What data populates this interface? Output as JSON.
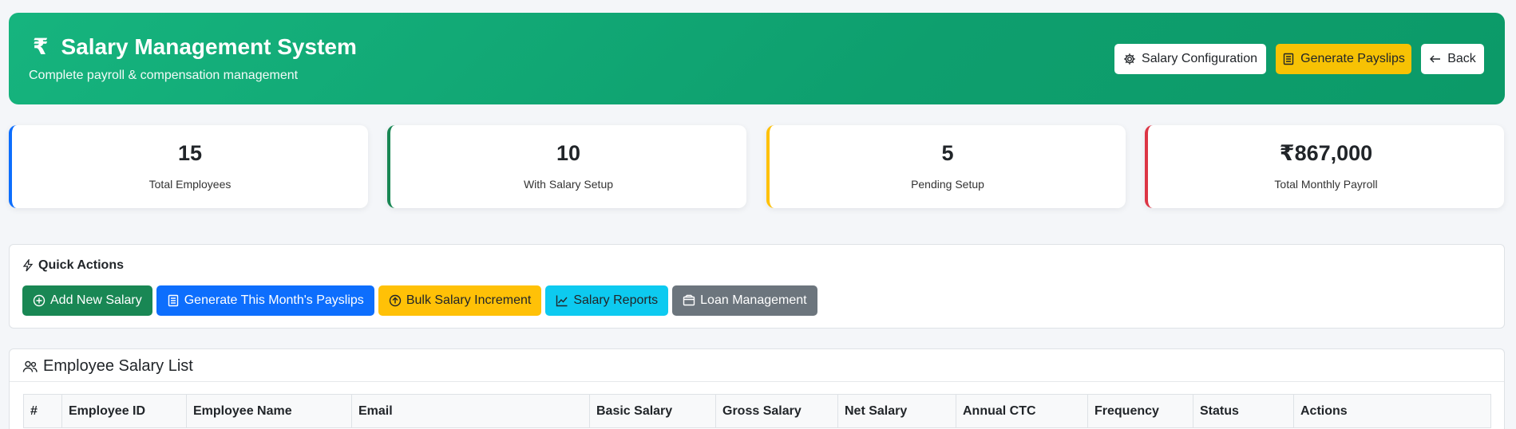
{
  "header": {
    "currency_symbol": "₹",
    "title": "Salary Management System",
    "subtitle": "Complete payroll & compensation management",
    "buttons": {
      "config": "Salary Configuration",
      "payslips": "Generate Payslips",
      "back": "Back"
    }
  },
  "stats": [
    {
      "value": "15",
      "label": "Total Employees",
      "color": "#0d6efd"
    },
    {
      "value": "10",
      "label": "With Salary Setup",
      "color": "#198754"
    },
    {
      "value": "5",
      "label": "Pending Setup",
      "color": "#ffc107"
    },
    {
      "value": "₹867,000",
      "label": "Total Monthly Payroll",
      "color": "#dc3545"
    }
  ],
  "quick_actions": {
    "title": "Quick Actions",
    "buttons": [
      {
        "label": "Add New Salary",
        "color": "#198754",
        "icon": "plus-circle-icon"
      },
      {
        "label": "Generate This Month's Payslips",
        "color": "#0d6efd",
        "icon": "receipt-icon"
      },
      {
        "label": "Bulk Salary Increment",
        "color": "#ffc107",
        "icon": "arrow-up-circle-icon"
      },
      {
        "label": "Salary Reports",
        "color": "#0dcaf0",
        "icon": "graph-up-icon"
      },
      {
        "label": "Loan Management",
        "color": "#6c757d",
        "icon": "wallet-icon"
      }
    ]
  },
  "employee_list": {
    "title": "Employee Salary List",
    "columns": [
      "#",
      "Employee ID",
      "Employee Name",
      "Email",
      "Basic Salary",
      "Gross Salary",
      "Net Salary",
      "Annual CTC",
      "Frequency",
      "Status",
      "Actions"
    ]
  }
}
